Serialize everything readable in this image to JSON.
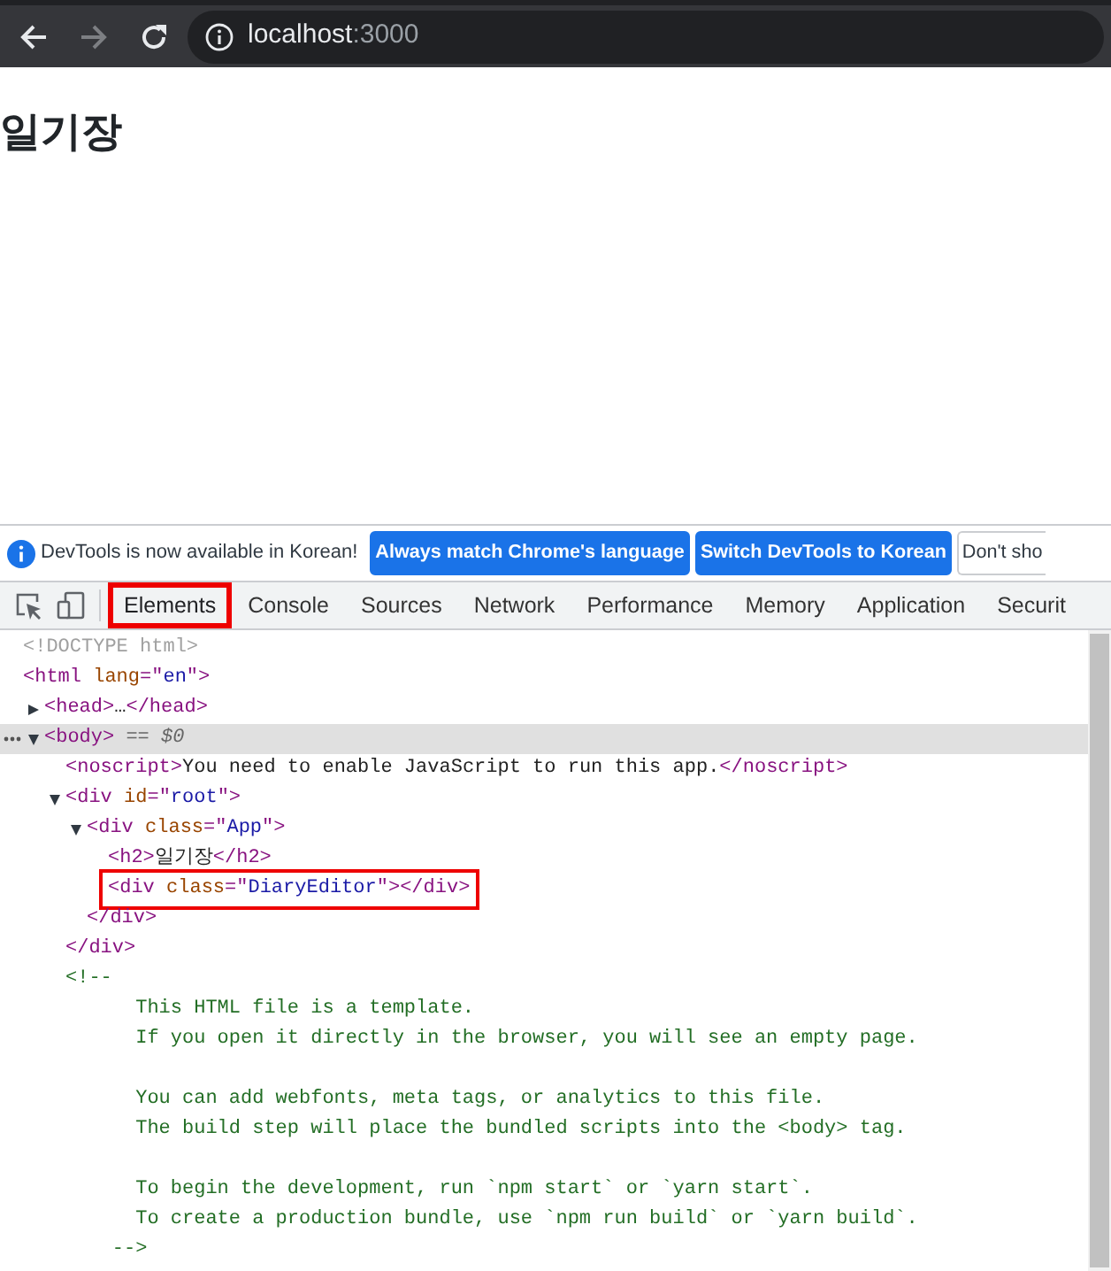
{
  "browser": {
    "back_disabled": false,
    "forward_disabled": true,
    "url_host": "localhost",
    "url_port": ":3000"
  },
  "page": {
    "heading": "일기장"
  },
  "devtools": {
    "banner": {
      "message": "DevTools is now available in Korean!",
      "buttons": [
        {
          "label": "Always match Chrome's language",
          "kind": "primary"
        },
        {
          "label": "Switch DevTools to Korean",
          "kind": "primary"
        },
        {
          "label": "Don't sho",
          "kind": "secondary"
        }
      ]
    },
    "tabs": [
      {
        "label": "Elements",
        "selected": true,
        "highlighted": true
      },
      {
        "label": "Console",
        "selected": false,
        "highlighted": false
      },
      {
        "label": "Sources",
        "selected": false,
        "highlighted": false
      },
      {
        "label": "Network",
        "selected": false,
        "highlighted": false
      },
      {
        "label": "Performance",
        "selected": false,
        "highlighted": false
      },
      {
        "label": "Memory",
        "selected": false,
        "highlighted": false
      },
      {
        "label": "Application",
        "selected": false,
        "highlighted": false
      },
      {
        "label": "Securit",
        "selected": false,
        "highlighted": false
      }
    ],
    "tree": [
      {
        "kind": "element",
        "line": [
          {
            "kind": "doctype",
            "text": "<!DOCTYPE html>"
          }
        ]
      },
      {
        "kind": "element",
        "line": [
          {
            "kind": "tag",
            "text": "<html "
          },
          {
            "kind": "attr-name",
            "text": "lang"
          },
          {
            "kind": "tag",
            "text": "=\""
          },
          {
            "kind": "attr-value",
            "text": "en"
          },
          {
            "kind": "tag",
            "text": "\">"
          }
        ],
        "children": [
          {
            "kind": "element",
            "expanded": false,
            "line": [
              {
                "kind": "tag",
                "text": "<head>"
              },
              {
                "kind": "text",
                "text": "…"
              },
              {
                "kind": "tag",
                "text": "</head>"
              }
            ]
          },
          {
            "kind": "element",
            "expanded": true,
            "selected": true,
            "line": [
              {
                "kind": "tag",
                "text": "<body>"
              },
              {
                "kind": "hint",
                "text": " == $0"
              }
            ],
            "children": [
              {
                "kind": "element",
                "line": [
                  {
                    "kind": "tag",
                    "text": "<noscript>"
                  },
                  {
                    "kind": "text",
                    "text": "You need to enable JavaScript to run this app."
                  },
                  {
                    "kind": "tag",
                    "text": "</noscript>"
                  }
                ]
              },
              {
                "kind": "element",
                "expanded": true,
                "line": [
                  {
                    "kind": "tag",
                    "text": "<div "
                  },
                  {
                    "kind": "attr-name",
                    "text": "id"
                  },
                  {
                    "kind": "tag",
                    "text": "=\""
                  },
                  {
                    "kind": "attr-value",
                    "text": "root"
                  },
                  {
                    "kind": "tag",
                    "text": "\">"
                  }
                ],
                "close": [
                  {
                    "kind": "tag",
                    "text": "</div>"
                  }
                ],
                "children": [
                  {
                    "kind": "element",
                    "expanded": true,
                    "line": [
                      {
                        "kind": "tag",
                        "text": "<div "
                      },
                      {
                        "kind": "attr-name",
                        "text": "class"
                      },
                      {
                        "kind": "tag",
                        "text": "=\""
                      },
                      {
                        "kind": "attr-value",
                        "text": "App"
                      },
                      {
                        "kind": "tag",
                        "text": "\">"
                      }
                    ],
                    "close": [
                      {
                        "kind": "tag",
                        "text": "</div>"
                      }
                    ],
                    "children": [
                      {
                        "kind": "element",
                        "line": [
                          {
                            "kind": "tag",
                            "text": "<h2>"
                          },
                          {
                            "kind": "text",
                            "text": "일기장"
                          },
                          {
                            "kind": "tag",
                            "text": "</h2>"
                          }
                        ]
                      },
                      {
                        "kind": "element",
                        "highlighted": true,
                        "line": [
                          {
                            "kind": "tag",
                            "text": "<div "
                          },
                          {
                            "kind": "attr-name",
                            "text": "class"
                          },
                          {
                            "kind": "tag",
                            "text": "=\""
                          },
                          {
                            "kind": "attr-value",
                            "text": "DiaryEditor"
                          },
                          {
                            "kind": "tag",
                            "text": "\">"
                          },
                          {
                            "kind": "tag",
                            "text": "</div>"
                          }
                        ]
                      }
                    ]
                  }
                ]
              },
              {
                "kind": "comment",
                "open": "<!--",
                "paragraphs": [
                  [
                    "This HTML file is a template.",
                    "If you open it directly in the browser, you will see an empty page."
                  ],
                  [
                    "You can add webfonts, meta tags, or analytics to this file.",
                    "The build step will place the bundled scripts into the <body> tag."
                  ],
                  [
                    "To begin the development, run `npm start` or `yarn start`.",
                    "To create a production bundle, use `npm run build` or `yarn build`."
                  ]
                ],
                "close": "-->"
              }
            ]
          }
        ]
      }
    ]
  }
}
